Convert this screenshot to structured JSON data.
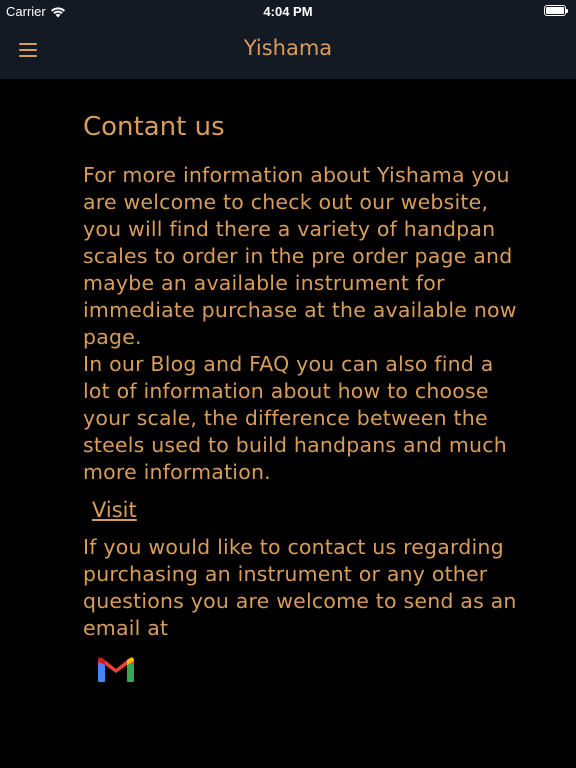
{
  "status_bar": {
    "carrier": "Carrier",
    "time": "4:04 PM"
  },
  "nav": {
    "title": "Yishama",
    "menu_icon": "hamburger-menu-icon"
  },
  "content": {
    "heading": "Contant us",
    "paragraph_1": "For more information about Yishama you are welcome to check out our website, you will find there a variety of handpan scales to order in the pre order page and maybe an available instrument for immediate purchase at the available now page.",
    "paragraph_2": "In our Blog and FAQ you can also find a lot of information about how to choose your scale, the difference between the steels used to build handpans and much more information.",
    "visit_label": "Visit",
    "paragraph_3": "If you would like to contact us regarding purchasing an instrument or any other questions you are welcome to send as an email at",
    "email_icon": "gmail-icon"
  },
  "colors": {
    "accent": "#d99d5b",
    "nav_background": "#141a24",
    "background": "#000000"
  }
}
